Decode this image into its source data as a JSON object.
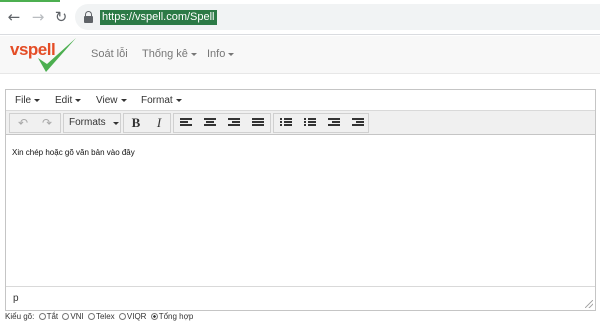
{
  "browser": {
    "url": "https://vspell.com/Spell"
  },
  "site": {
    "logo_text": "vspell",
    "nav": [
      {
        "label": "Soát lỗi"
      },
      {
        "label": "Thống kê"
      },
      {
        "label": "Info"
      }
    ]
  },
  "editor": {
    "menu": [
      "File",
      "Edit",
      "View",
      "Format"
    ],
    "formats_label": "Formats",
    "bold_label": "B",
    "italic_label": "I",
    "placeholder": "Xin chép hoặc gõ văn bản vào đây",
    "status_path": "p"
  },
  "input_mode": {
    "label": "Kiểu gõ",
    "options": [
      "Tắt",
      "VNI",
      "Telex",
      "VIQR",
      "Tổng hợp"
    ],
    "selected": "Tổng hợp"
  },
  "colors": {
    "logo_text": "#e44d26",
    "logo_check": "#4caf50",
    "url_highlight": "#2c7a46"
  }
}
